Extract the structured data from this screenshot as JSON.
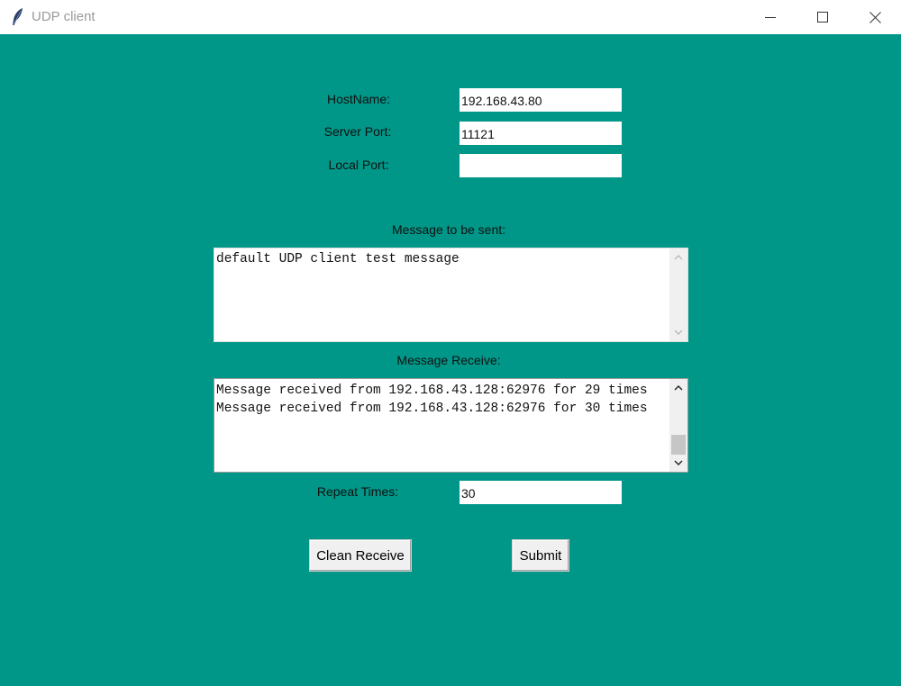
{
  "window": {
    "title": "UDP client",
    "icon": "feather-icon",
    "controls": [
      "minimize-icon",
      "maximize-icon",
      "close-icon"
    ]
  },
  "form": {
    "hostname_label": "HostName:",
    "hostname_value": "192.168.43.80",
    "server_port_label": "Server Port:",
    "server_port_value": "11121",
    "local_port_label": "Local Port:",
    "local_port_value": "",
    "message_sent_label": "Message to be sent:",
    "message_sent_value": "default UDP client test message",
    "message_receive_label": "Message Receive:",
    "message_receive_value": "Message received from 192.168.43.128:62976 for 29 times\nMessage received from 192.168.43.128:62976 for 30 times",
    "repeat_label": "Repeat Times:",
    "repeat_value": "30"
  },
  "buttons": {
    "clean_label": "Clean Receive",
    "submit_label": "Submit"
  },
  "colors": {
    "background": "#009688",
    "titlebar": "#ffffff",
    "field": "#ffffff"
  }
}
